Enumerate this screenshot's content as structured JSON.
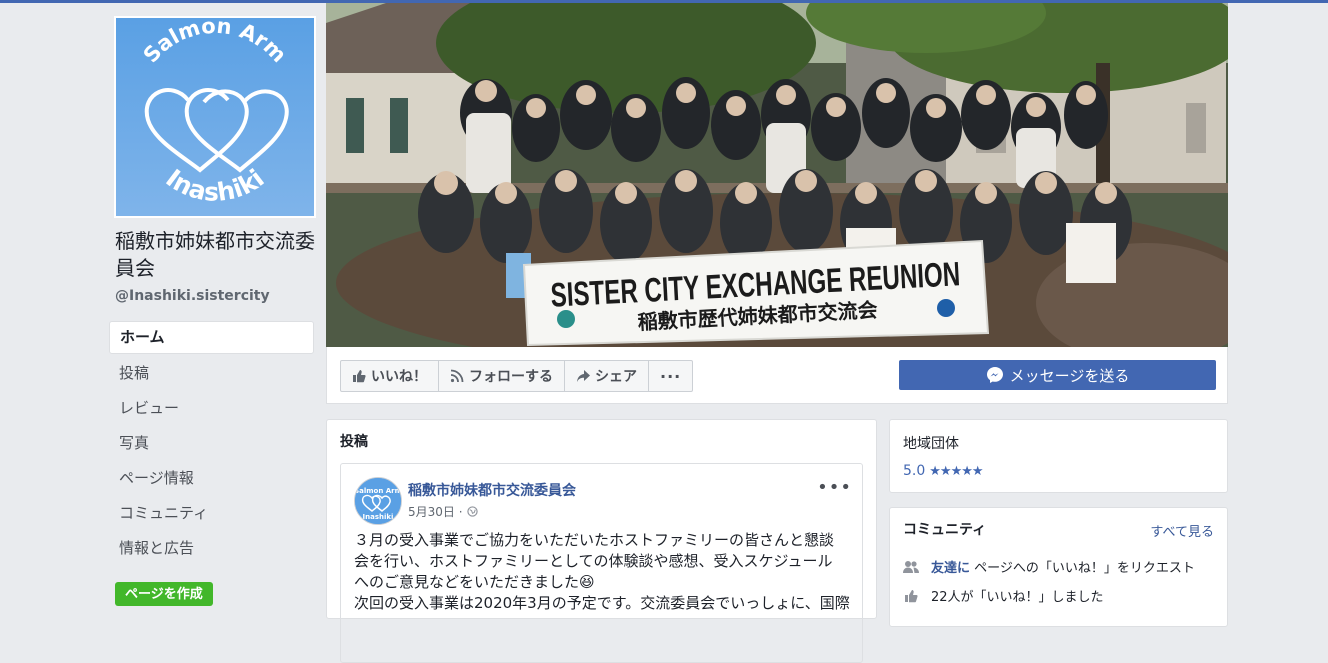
{
  "page": {
    "name": "稲敷市姉妹都市交流委員会",
    "handle": "@Inashiki.sistercity",
    "logo_text_top": "Salmon Arm",
    "logo_text_bottom": "Inashiki"
  },
  "cover": {
    "banner_line1": "SISTER CITY EXCHANGE REUNION",
    "banner_line2": "稲敷市歴代姉妹都市交流会"
  },
  "sidebar": {
    "items": [
      {
        "label": "ホーム",
        "active": true
      },
      {
        "label": "投稿"
      },
      {
        "label": "レビュー"
      },
      {
        "label": "写真"
      },
      {
        "label": "ページ情報"
      },
      {
        "label": "コミュニティ"
      },
      {
        "label": "情報と広告"
      }
    ],
    "create_page_label": "ページを作成"
  },
  "actions": {
    "like_label": "いいね！",
    "follow_label": "フォローする",
    "share_label": "シェア",
    "more_label": "···",
    "message_label": "メッセージを送る"
  },
  "posts": {
    "title": "投稿",
    "post": {
      "author": "稲敷市姉妹都市交流委員会",
      "date": "5月30日 ·",
      "line1": "３月の受入事業でご協力をいただいたホストファミリーの皆さんと懇談",
      "line2": "会を行い、ホストファミリーとしての体験談や感想、受入スケジュール",
      "line3": "へのご意見などをいただきました😆",
      "line4": "次回の受入事業は2020年3月の予定です。交流委員会でいっしょに、国際"
    }
  },
  "about": {
    "category": "地域団体",
    "rating": "5.0",
    "stars": "★★★★★"
  },
  "community": {
    "title": "コミュニティ",
    "see_all": "すべて見る",
    "invite_link": "友達に",
    "invite_rest": "ページへの「いいね！」をリクエスト",
    "likes_text": "22人が「いいね！」しました"
  },
  "colors": {
    "brand_blue": "#4267b2",
    "link_blue": "#385898",
    "green": "#42b72a",
    "background": "#e9ebee"
  }
}
